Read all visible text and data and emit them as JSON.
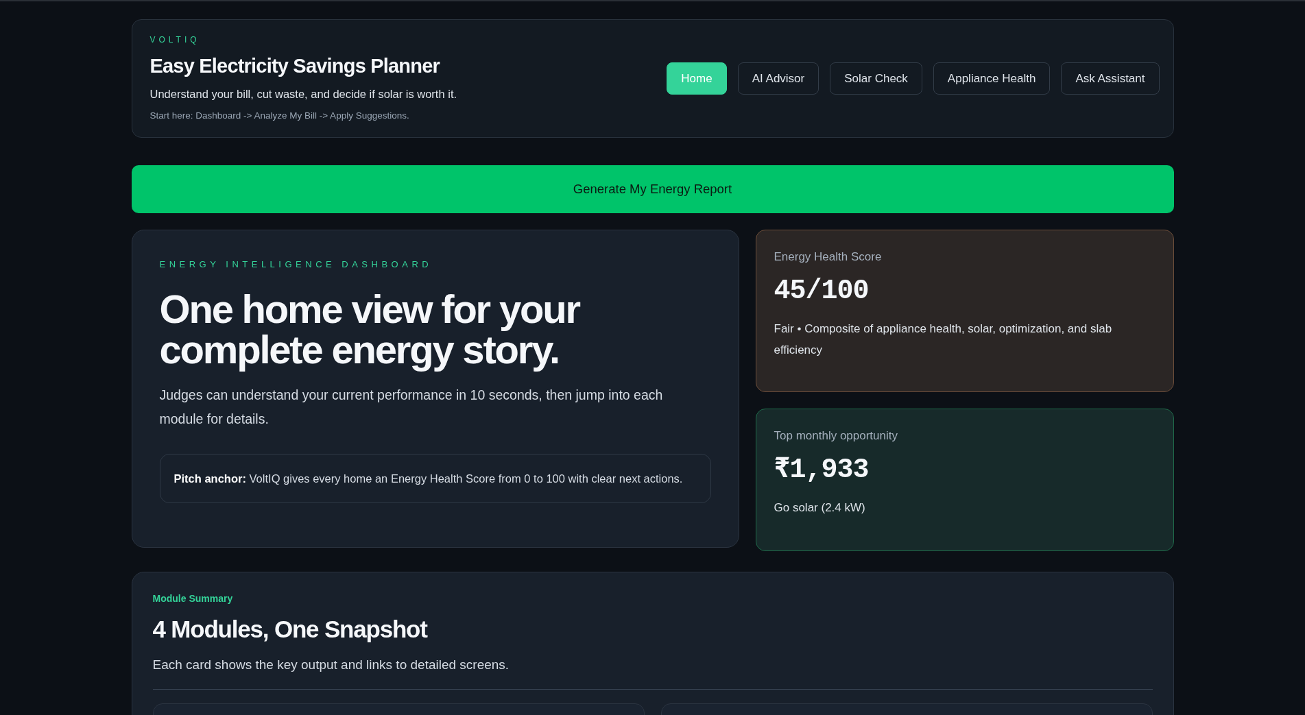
{
  "header": {
    "brand": "VOLTIQ",
    "title": "Easy Electricity Savings Planner",
    "subtitle": "Understand your bill, cut waste, and decide if solar is worth it.",
    "hint": "Start here: Dashboard -> Analyze My Bill -> Apply Suggestions."
  },
  "nav": [
    {
      "label": "Home",
      "selected": true
    },
    {
      "label": "AI Advisor",
      "selected": false
    },
    {
      "label": "Solar Check",
      "selected": false
    },
    {
      "label": "Appliance Health",
      "selected": false
    },
    {
      "label": "Ask Assistant",
      "selected": false
    }
  ],
  "cta": {
    "label": "Generate My Energy Report"
  },
  "hero": {
    "kicker": "ENERGY INTELLIGENCE DASHBOARD",
    "headline": "One home view for your complete energy story.",
    "description": "Judges can understand your current performance in 10 seconds, then jump into each module for details.",
    "pitch": "**Pitch anchor:** VoltIQ gives every home an Energy Health Score from 0 to 100 with clear next actions."
  },
  "stats": [
    {
      "kind": "score",
      "label": "Energy Health Score",
      "value": "45/100",
      "detail": "Fair • Composite of appliance health, solar, optimization, and slab efficiency"
    },
    {
      "kind": "opportunity",
      "label": "Top monthly opportunity",
      "value": "₹1,933",
      "detail": "Go solar (2.4 kW)"
    }
  ],
  "summary": {
    "kicker": "Module Summary",
    "title": "4 Modules, One Snapshot",
    "description": "Each card shows the key output and links to detailed screens."
  }
}
